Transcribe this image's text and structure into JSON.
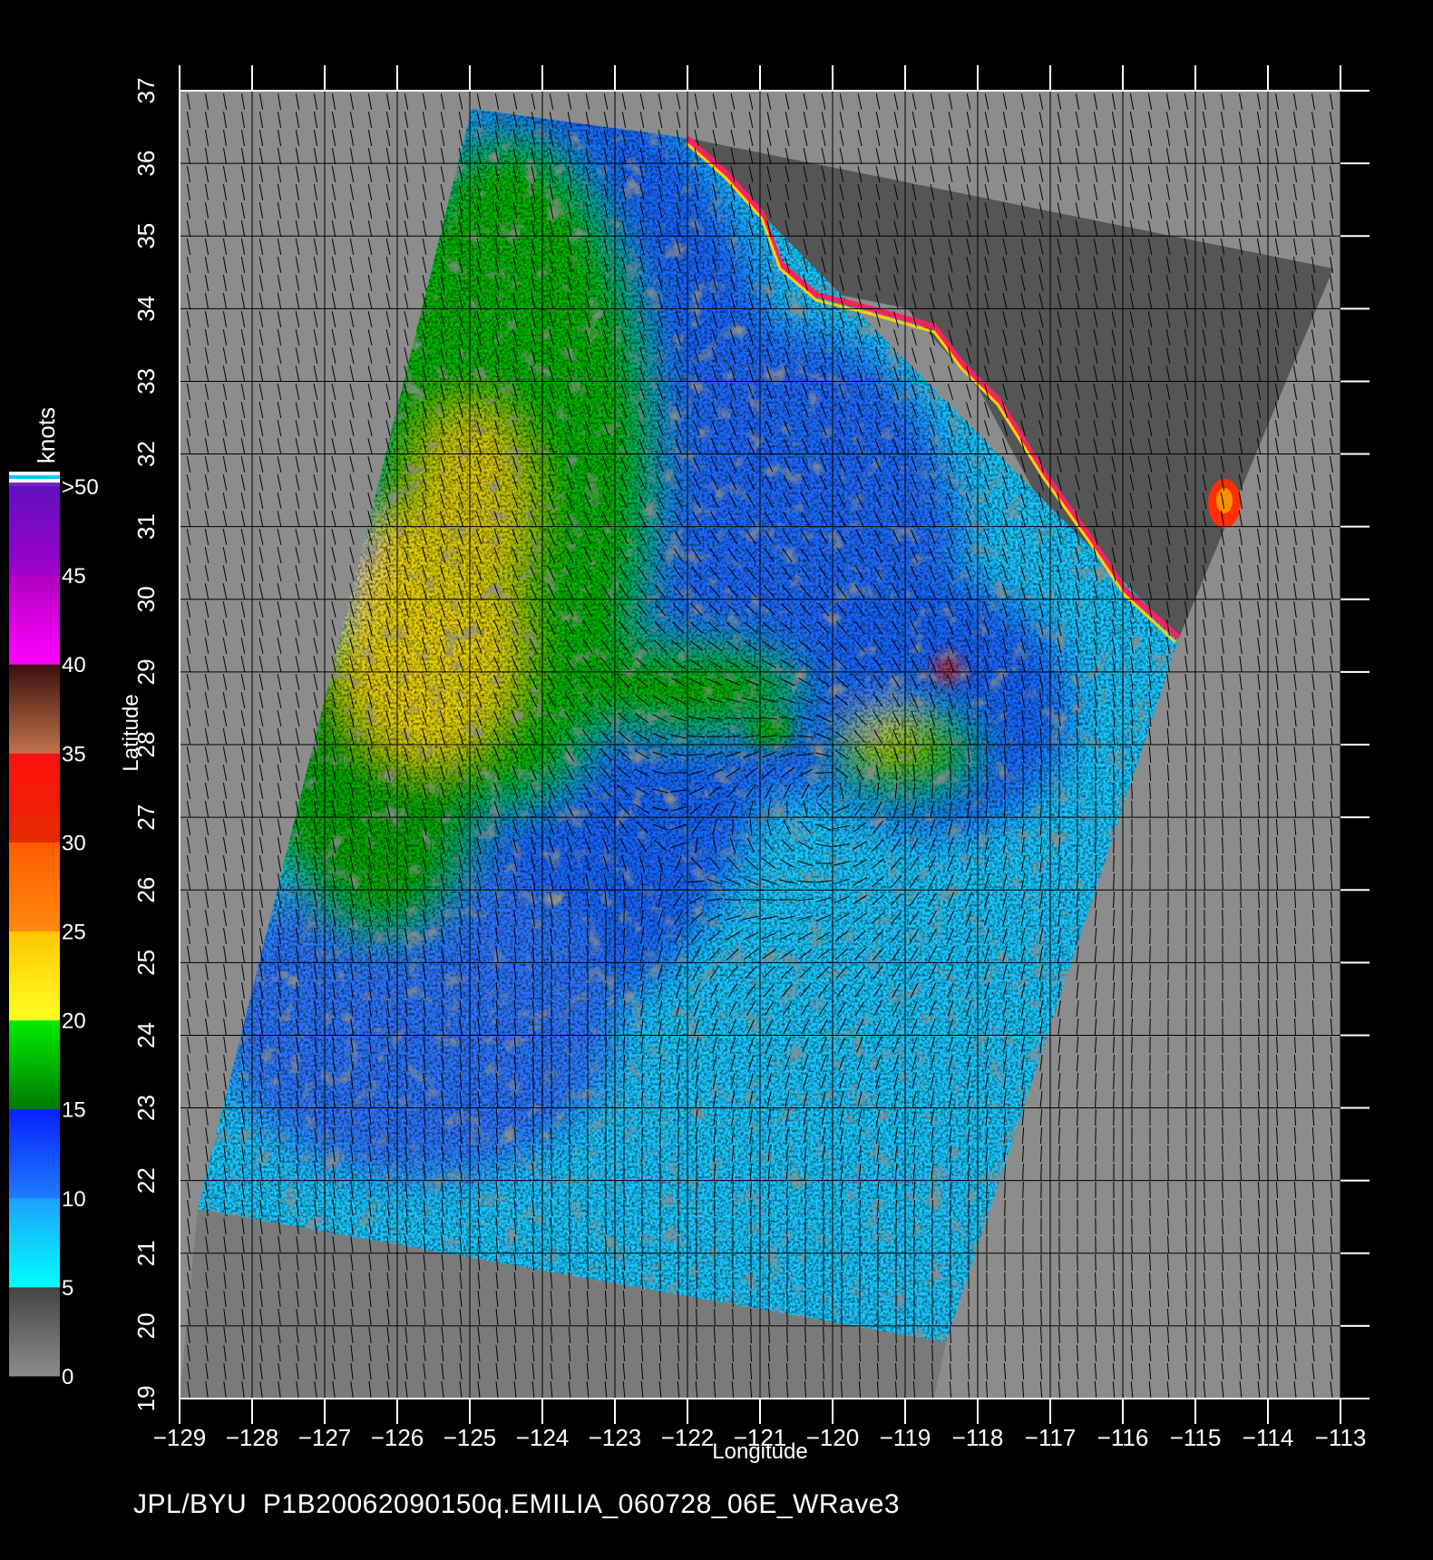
{
  "colorbar": {
    "title": "knots",
    "labels": [
      ">50",
      "45",
      "40",
      "35",
      "30",
      "25",
      "20",
      "15",
      "10",
      "5",
      "0"
    ],
    "bands": [
      {
        "from": 0,
        "to": 5,
        "top": "#444444",
        "bottom": "#8c8c8c"
      },
      {
        "from": 5,
        "to": 10,
        "top": "#1ea0ff",
        "bottom": "#00ffff"
      },
      {
        "from": 10,
        "to": 15,
        "top": "#0a20ff",
        "bottom": "#1e7bff"
      },
      {
        "from": 15,
        "to": 20,
        "top": "#00ee00",
        "bottom": "#007a00"
      },
      {
        "from": 20,
        "to": 25,
        "top": "#ffc400",
        "bottom": "#ffff22"
      },
      {
        "from": 25,
        "to": 30,
        "top": "#ff5a00",
        "bottom": "#ff8a10"
      },
      {
        "from": 30,
        "to": 35,
        "top": "#ff1010",
        "bottom": "#e52a00"
      },
      {
        "from": 35,
        "to": 40,
        "top": "#3a1010",
        "bottom": "#c2724a"
      },
      {
        "from": 40,
        "to": 45,
        "top": "#b000c0",
        "bottom": "#ff00ff"
      },
      {
        "from": 45,
        "to": 50,
        "top": "#6010c0",
        "bottom": "#a000c8"
      }
    ],
    "top_stripes": [
      "#ffffff",
      "#00ccff",
      "#ffffff",
      "#7a22cc"
    ]
  },
  "map": {
    "x_axis_label": "Longitude",
    "y_axis_label": "Latitude",
    "lon_ticks": [
      "-129",
      "-128",
      "-127",
      "-126",
      "-125",
      "-124",
      "-123",
      "-122",
      "-121",
      "-120",
      "-119",
      "-118",
      "-117",
      "-116",
      "-115",
      "-114",
      "-113"
    ],
    "lat_ticks": [
      "19",
      "20",
      "21",
      "22",
      "23",
      "24",
      "25",
      "26",
      "27",
      "28",
      "29",
      "30",
      "31",
      "32",
      "33",
      "34",
      "35",
      "36",
      "37"
    ],
    "lon_range": [
      -129,
      -113
    ],
    "lat_range": [
      19,
      37
    ],
    "storm_center": {
      "lon": -120.0,
      "lat": 27.3
    },
    "colors": {
      "background": "#000000",
      "no_data": "#8c8c8c",
      "land": "#555555",
      "light_wind": "#00e0ff",
      "moderate_wind": "#1466ff",
      "strong_wind": "#00b400",
      "gale": "#ffd000"
    }
  },
  "footer": {
    "text": "JPL/BYU  P1B20062090150q.EMILIA_060728_06E_WRave3"
  }
}
